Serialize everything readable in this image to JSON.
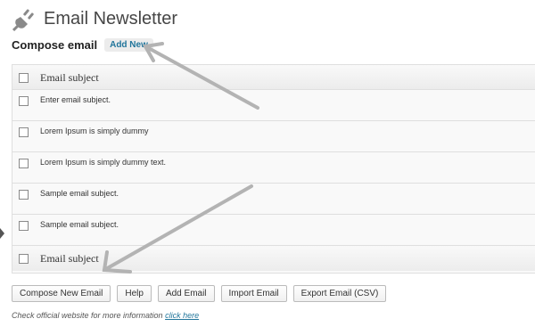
{
  "header": {
    "title": "Email Newsletter",
    "icon": "plug-icon"
  },
  "subhead": {
    "title": "Compose email",
    "add_new_label": "Add New"
  },
  "table": {
    "column_header": "Email subject",
    "column_footer": "Email subject",
    "rows": [
      {
        "subject": "Enter email subject."
      },
      {
        "subject": "Lorem Ipsum is simply dummy"
      },
      {
        "subject": "Lorem Ipsum is simply dummy text."
      },
      {
        "subject": "Sample email subject."
      },
      {
        "subject": "Sample email subject."
      }
    ]
  },
  "actions": {
    "compose": "Compose New Email",
    "help": "Help",
    "add_email": "Add Email",
    "import_email": "Import Email",
    "export_email": "Export Email (CSV)"
  },
  "footer_note": {
    "text": "Check official website for more information",
    "link_text": "click here"
  },
  "colors": {
    "link": "#21759b",
    "annotation_arrow": "#b3b3b3"
  }
}
